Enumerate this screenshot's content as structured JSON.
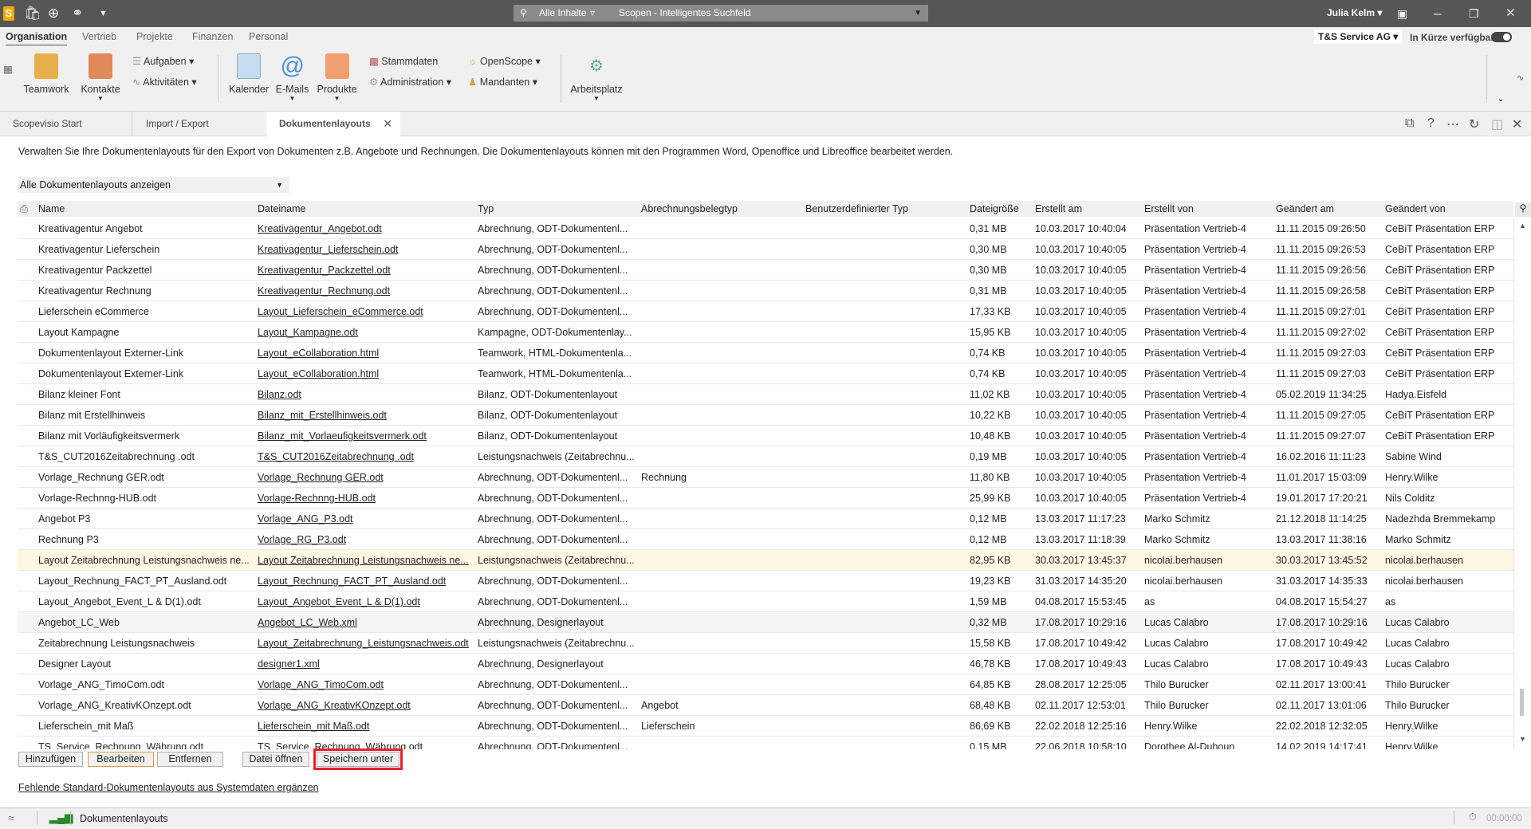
{
  "titlebar": {
    "search_scope": "Alle Inhalte",
    "search_placeholder": "Scopen - Intelligentes Suchfeld",
    "user": "Julia Kelm"
  },
  "module_tabs": [
    "Organisation",
    "Vertrieb",
    "Projekte",
    "Finanzen",
    "Personal"
  ],
  "company": "T&S Service AG",
  "availability": "In Kürze verfügbar",
  "availability_on": true,
  "ribbon": {
    "teamwork": "Teamwork",
    "kontakte": "Kontakte",
    "aufgaben": "Aufgaben",
    "aktivitaeten": "Aktivitäten",
    "kalender": "Kalender",
    "emails": "E-Mails",
    "produkte": "Produkte",
    "stammdaten": "Stammdaten",
    "administration": "Administration",
    "openscope": "OpenScope",
    "mandanten": "Mandanten",
    "arbeitsplatz": "Arbeitsplatz"
  },
  "doc_tabs": [
    "Scopevisio Start",
    "Import / Export",
    "Dokumentenlayouts"
  ],
  "description": "Verwalten Sie Ihre Dokumentenlayouts für den Export von Dokumenten z.B. Angebote und Rechnungen. Die Dokumentenlayouts können mit den Programmen Word, Openoffice und Libreoffice bearbeitet werden.",
  "filter": "Alle Dokumentenlayouts anzeigen",
  "columns": [
    "Name",
    "Dateiname",
    "Typ",
    "Abrechnungsbelegtyp",
    "Benutzerdefinierter Typ",
    "Dateigröße",
    "Erstellt am",
    "Erstellt von",
    "Geändert am",
    "Geändert von"
  ],
  "rows": [
    [
      "Kreativagentur Angebot",
      "Kreativagentur_Angebot.odt",
      "Abrechnung, ODT-Dokumentenl...",
      "",
      "",
      "0,31 MB",
      "10.03.2017 10:40:04",
      "Präsentation Vertrieb-4",
      "11.11.2015 09:26:50",
      "CeBiT Präsentation ERP"
    ],
    [
      "Kreativagentur Lieferschein",
      "Kreativagentur_Lieferschein.odt",
      "Abrechnung, ODT-Dokumentenl...",
      "",
      "",
      "0,30 MB",
      "10.03.2017 10:40:05",
      "Präsentation Vertrieb-4",
      "11.11.2015 09:26:53",
      "CeBiT Präsentation ERP"
    ],
    [
      "Kreativagentur Packzettel",
      "Kreativagentur_Packzettel.odt",
      "Abrechnung, ODT-Dokumentenl...",
      "",
      "",
      "0,30 MB",
      "10.03.2017 10:40:05",
      "Präsentation Vertrieb-4",
      "11.11.2015 09:26:56",
      "CeBiT Präsentation ERP"
    ],
    [
      "Kreativagentur Rechnung",
      "Kreativagentur_Rechnung.odt",
      "Abrechnung, ODT-Dokumentenl...",
      "",
      "",
      "0,31 MB",
      "10.03.2017 10:40:05",
      "Präsentation Vertrieb-4",
      "11.11.2015 09:26:58",
      "CeBiT Präsentation ERP"
    ],
    [
      "Lieferschein eCommerce",
      "Layout_Lieferschein_eCommerce.odt",
      "Abrechnung, ODT-Dokumentenl...",
      "",
      "",
      "17,33 KB",
      "10.03.2017 10:40:05",
      "Präsentation Vertrieb-4",
      "11.11.2015 09:27:01",
      "CeBiT Präsentation ERP"
    ],
    [
      "Layout Kampagne",
      "Layout_Kampagne.odt",
      "Kampagne, ODT-Dokumentenlay...",
      "",
      "",
      "15,95 KB",
      "10.03.2017 10:40:05",
      "Präsentation Vertrieb-4",
      "11.11.2015 09:27:02",
      "CeBiT Präsentation ERP"
    ],
    [
      "Dokumentenlayout Externer-Link",
      "Layout_eCollaboration.html",
      "Teamwork, HTML-Dokumentenla...",
      "",
      "",
      "0,74 KB",
      "10.03.2017 10:40:05",
      "Präsentation Vertrieb-4",
      "11.11.2015 09:27:03",
      "CeBiT Präsentation ERP"
    ],
    [
      "Dokumentenlayout Externer-Link",
      "Layout_eCollaboration.html",
      "Teamwork, HTML-Dokumentenla...",
      "",
      "",
      "0,74 KB",
      "10.03.2017 10:40:05",
      "Präsentation Vertrieb-4",
      "11.11.2015 09:27:03",
      "CeBiT Präsentation ERP"
    ],
    [
      "Bilanz kleiner Font",
      "Bilanz.odt",
      "Bilanz, ODT-Dokumentenlayout",
      "",
      "",
      "11,02 KB",
      "10.03.2017 10:40:05",
      "Präsentation Vertrieb-4",
      "05.02.2019 11:34:25",
      "Hadya.Eisfeld"
    ],
    [
      "Bilanz mit Erstellhinweis",
      "Bilanz_mit_Erstellhinweis.odt",
      "Bilanz, ODT-Dokumentenlayout",
      "",
      "",
      "10,22 KB",
      "10.03.2017 10:40:05",
      "Präsentation Vertrieb-4",
      "11.11.2015 09:27:05",
      "CeBiT Präsentation ERP"
    ],
    [
      "Bilanz mit Vorläufigkeitsvermerk",
      "Bilanz_mit_Vorlaeufigkeitsvermerk.odt",
      "Bilanz, ODT-Dokumentenlayout",
      "",
      "",
      "10,48 KB",
      "10.03.2017 10:40:05",
      "Präsentation Vertrieb-4",
      "11.11.2015 09:27:07",
      "CeBiT Präsentation ERP"
    ],
    [
      "T&S_CUT2016Zeitabrechnung .odt",
      "T&S_CUT2016Zeitabrechnung .odt",
      "Leistungsnachweis (Zeitabrechnu...",
      "",
      "",
      "0,19 MB",
      "10.03.2017 10:40:05",
      "Präsentation Vertrieb-4",
      "16.02.2016 11:11:23",
      "Sabine Wind"
    ],
    [
      "Vorlage_Rechnung GER.odt",
      "Vorlage_Rechnung GER.odt",
      "Abrechnung, ODT-Dokumentenl...",
      "Rechnung",
      "",
      "11,80 KB",
      "10.03.2017 10:40:05",
      "Präsentation Vertrieb-4",
      "11.01.2017 15:03:09",
      "Henry.Wilke"
    ],
    [
      "Vorlage-Rechnng-HUB.odt",
      "Vorlage-Rechnng-HUB.odt",
      "Abrechnung, ODT-Dokumentenl...",
      "",
      "",
      "25,99 KB",
      "10.03.2017 10:40:05",
      "Präsentation Vertrieb-4",
      "19.01.2017 17:20:21",
      "Nils Colditz"
    ],
    [
      "Angebot P3",
      "Vorlage_ANG_P3.odt",
      "Abrechnung, ODT-Dokumentenl...",
      "",
      "",
      "0,12 MB",
      "13.03.2017 11:17:23",
      "Marko Schmitz",
      "21.12.2018 11:14:25",
      "Nadezhda Bremmekamp"
    ],
    [
      "Rechnung P3",
      "Vorlage_RG_P3.odt",
      "Abrechnung, ODT-Dokumentenl...",
      "",
      "",
      "0,12 MB",
      "13.03.2017 11:18:39",
      "Marko Schmitz",
      "13.03.2017 11:38:16",
      "Marko Schmitz"
    ],
    [
      "Layout Zeitabrechnung Leistungsnachweis ne...",
      "Layout Zeitabrechnung Leistungsnachweis ne...",
      "Leistungsnachweis (Zeitabrechnu...",
      "",
      "",
      "82,95 KB",
      "30.03.2017 13:45:37",
      "nicolai.berhausen",
      "30.03.2017 13:45:52",
      "nicolai.berhausen"
    ],
    [
      "Layout_Rechnung_FACT_PT_Ausland.odt",
      "Layout_Rechnung_FACT_PT_Ausland.odt",
      "Abrechnung, ODT-Dokumentenl...",
      "",
      "",
      "19,23 KB",
      "31.03.2017 14:35:20",
      "nicolai.berhausen",
      "31.03.2017 14:35:33",
      "nicolai.berhausen"
    ],
    [
      "Layout_Angebot_Event_L & D(1).odt",
      "Layout_Angebot_Event_L & D(1).odt",
      "Abrechnung, ODT-Dokumentenl...",
      "",
      "",
      "1,59 MB",
      "04.08.2017 15:53:45",
      "as",
      "04.08.2017 15:54:27",
      "as"
    ],
    [
      "Angebot_LC_Web",
      "Angebot_LC_Web.xml",
      "Abrechnung, Designerlayout",
      "",
      "",
      "0,32 MB",
      "17.08.2017 10:29:16",
      "Lucas Calabro",
      "17.08.2017 10:29:16",
      "Lucas Calabro"
    ],
    [
      "Zeitabrechnung Leistungsnachweis",
      "Layout_Zeitabrechnung_Leistungsnachweis.odt",
      "Leistungsnachweis (Zeitabrechnu...",
      "",
      "",
      "15,58 KB",
      "17.08.2017 10:49:42",
      "Lucas Calabro",
      "17.08.2017 10:49:42",
      "Lucas Calabro"
    ],
    [
      "Designer Layout",
      "designer1.xml",
      "Abrechnung, Designerlayout",
      "",
      "",
      "46,78 KB",
      "17.08.2017 10:49:43",
      "Lucas Calabro",
      "17.08.2017 10:49:43",
      "Lucas Calabro"
    ],
    [
      "Vorlage_ANG_TimoCom.odt",
      "Vorlage_ANG_TimoCom.odt",
      "Abrechnung, ODT-Dokumentenl...",
      "",
      "",
      "64,85 KB",
      "28.08.2017 12:25:05",
      "Thilo Burucker",
      "02.11.2017 13:00:41",
      "Thilo Burucker"
    ],
    [
      "Vorlage_ANG_KreativKOnzept.odt",
      "Vorlage_ANG_KreativKOnzept.odt",
      "Abrechnung, ODT-Dokumentenl...",
      "Angebot",
      "",
      "68,48 KB",
      "02.11.2017 12:53:01",
      "Thilo Burucker",
      "02.11.2017 13:01:06",
      "Thilo Burucker"
    ],
    [
      "Lieferschein_mit Maß",
      "Lieferschein_mit Maß.odt",
      "Abrechnung, ODT-Dokumentenl...",
      "Lieferschein",
      "",
      "86,69 KB",
      "22.02.2018 12:25:16",
      "Henry.Wilke",
      "22.02.2018 12:32:05",
      "Henry.Wilke"
    ],
    [
      "TS_Service_Rechnung_Währung.odt",
      "TS_Service_Rechnung_Währung.odt",
      "Abrechnung, ODT-Dokumentenl...",
      "",
      "",
      "0,15 MB",
      "22.06.2018 10:58:10",
      "Dorothee Al-Duhoun",
      "14.02.2019 14:17:41",
      "Henry.Wilke"
    ]
  ],
  "selected_row": 16,
  "hover_row": 19,
  "buttons": {
    "add": "Hinzufügen",
    "edit": "Bearbeiten",
    "remove": "Entfernen",
    "open": "Datei öffnen",
    "save_as": "Speichern unter"
  },
  "link": "Fehlende Standard-Dokumentenlayouts aus Systemdaten ergänzen",
  "status": {
    "label": "Dokumentenlayouts",
    "timer": "00:00:00"
  },
  "colors": {
    "titlebar": "#565656",
    "selected_row": "#fdf8e4",
    "highlight": "#e8202a"
  }
}
